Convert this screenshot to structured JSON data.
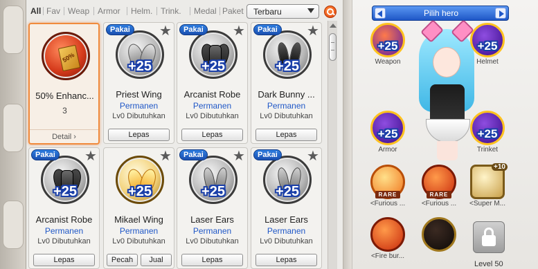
{
  "filters": [
    "All",
    "Fav",
    "Weap",
    "Armor",
    "Helm.",
    "Trink.",
    "Medal",
    "Paket"
  ],
  "sort": {
    "selected": "Terbaru"
  },
  "items": [
    {
      "name": "50% Enhanc...",
      "count": "3",
      "detail": "Detail ›",
      "selected": true
    },
    {
      "name": "Priest Wing",
      "badge": "Pakai",
      "bonus": "+25",
      "duration": "Permanen",
      "req": "Lv0 Dibutuhkan",
      "buttons": [
        "Lepas"
      ]
    },
    {
      "name": "Arcanist Robe",
      "badge": "Pakai",
      "bonus": "+25",
      "duration": "Permanen",
      "req": "Lv0 Dibutuhkan",
      "buttons": [
        "Lepas"
      ]
    },
    {
      "name": "Dark Bunny ...",
      "badge": "Pakai",
      "bonus": "+25",
      "duration": "Permanen",
      "req": "Lv0 Dibutuhkan",
      "buttons": [
        "Lepas"
      ]
    },
    {
      "name": "Arcanist Robe",
      "badge": "Pakai",
      "bonus": "+25",
      "duration": "Permanen",
      "req": "Lv0 Dibutuhkan",
      "buttons": [
        "Lepas"
      ]
    },
    {
      "name": "Mikael Wing",
      "bonus": "+25",
      "duration": "Permanen",
      "req": "Lv0 Dibutuhkan",
      "buttons": [
        "Pecah",
        "Jual"
      ]
    },
    {
      "name": "Laser Ears",
      "badge": "Pakai",
      "bonus": "+25",
      "duration": "Permanen",
      "req": "Lv0 Dibutuhkan",
      "buttons": [
        "Lepas"
      ]
    },
    {
      "name": "Laser Ears",
      "badge": "Pakai",
      "bonus": "+25",
      "duration": "Permanen",
      "req": "Lv0 Dibutuhkan",
      "buttons": [
        "Lepas"
      ]
    }
  ],
  "coupon_text": "50%",
  "hero": {
    "title": "Pilih hero",
    "slots": [
      {
        "label": "Weapon",
        "bonus": "+25"
      },
      {
        "label": "Helmet",
        "bonus": "+25"
      },
      {
        "label": "Armor",
        "bonus": "+25"
      },
      {
        "label": "Trinket",
        "bonus": "+25"
      }
    ],
    "skills": [
      {
        "label": "<Furious ...",
        "tag": "RARE"
      },
      {
        "label": "<Furious ...",
        "tag": "RARE"
      },
      {
        "label": "<Super M...",
        "tag": "+10"
      },
      {
        "label": "<Fire bur..."
      },
      {
        "label": ""
      }
    ],
    "level_label": "Level 50"
  }
}
